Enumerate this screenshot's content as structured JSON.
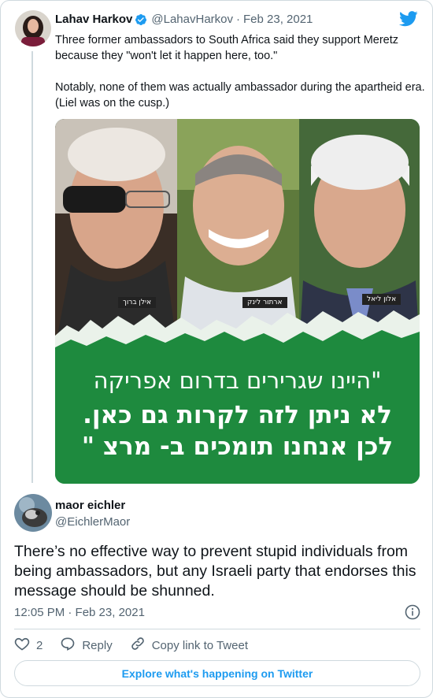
{
  "quoted_tweet": {
    "author_name": "Lahav Harkov",
    "handle": "@LahavHarkov",
    "separator": "·",
    "date": "Feb 23, 2021",
    "text_line_1": "Three former ambassadors to South Africa said they support Meretz because they \"won't let it happen here, too.\"",
    "text_line_2": "Notably, none of them was actually ambassador during the apartheid era. (Liel was on the cusp.)",
    "media": {
      "name_tag_1": "אילן ברוך",
      "name_tag_2": "ארתור לינק",
      "name_tag_3": "אלון ליאל",
      "headline_1": "\"היינו שגרירים בדרום אפריקה",
      "headline_2": "לא ניתן לזה לקרות גם כאן.",
      "headline_3": "לכן אנחנו תומכים ב- מרצ \""
    }
  },
  "tweet": {
    "author_name": "maor eichler",
    "handle": "@EichlerMaor",
    "text": "There’s no effective way to prevent stupid individuals from being ambassadors, but any Israeli party that endorses this message should be shunned.",
    "timestamp": "12:05 PM · Feb 23, 2021"
  },
  "actions": {
    "like_count": "2",
    "reply_label": "Reply",
    "copy_link_label": "Copy link to Tweet"
  },
  "explore_label": "Explore what's happening on Twitter",
  "colors": {
    "twitter_blue": "#1d9bf0",
    "text_primary": "#0f1419",
    "text_secondary": "#536471",
    "border": "#cfd9de",
    "banner_green": "#1e8a3e"
  },
  "icons": [
    "verified-badge-icon",
    "twitter-bird-icon",
    "info-icon",
    "heart-icon",
    "reply-icon",
    "link-icon"
  ]
}
